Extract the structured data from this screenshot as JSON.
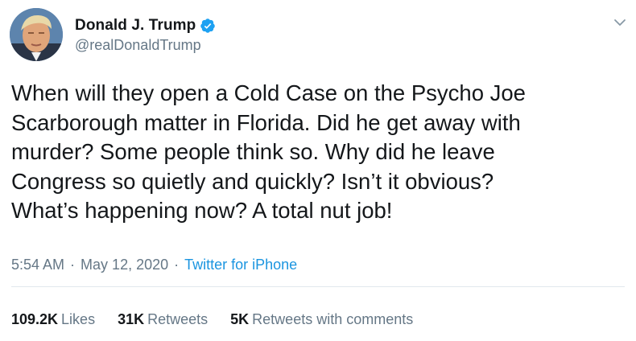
{
  "author": {
    "display_name": "Donald J. Trump",
    "handle": "@realDonaldTrump",
    "verified": true
  },
  "tweet": {
    "text": "When will they open a Cold Case on the Psycho Joe\nScarborough matter in Florida. Did he get away with\nmurder? Some people think so. Why did he leave\nCongress so quietly and quickly? Isn’t it obvious?\nWhat’s happening now? A total nut job!",
    "time": "5:54 AM",
    "separator": "·",
    "date": "May 12, 2020",
    "source": "Twitter for iPhone"
  },
  "stats": {
    "likes": {
      "value": "109.2K",
      "label": "Likes"
    },
    "retweets": {
      "value": "31K",
      "label": "Retweets"
    },
    "retweets_with_comments": {
      "value": "5K",
      "label": "Retweets with comments"
    }
  },
  "icons": {
    "verified": "verified-badge-icon",
    "menu": "chevron-down-icon"
  },
  "colors": {
    "text": "#14171a",
    "secondary": "#657786",
    "link": "#1b95e0",
    "verified": "#1da1f2",
    "divider": "#e1e8ed"
  }
}
